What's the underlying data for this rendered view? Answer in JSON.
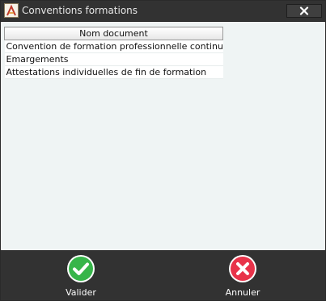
{
  "window": {
    "title": "Conventions formations",
    "icon": "app-logo-icon",
    "close_icon": "close-icon"
  },
  "table": {
    "column_header": "Nom document",
    "rows": [
      "Convention de formation professionnelle continue",
      "Emargements",
      "Attestations individuelles de fin de formation"
    ]
  },
  "footer": {
    "validate_label": "Valider",
    "cancel_label": "Annuler",
    "validate_icon": "check-icon",
    "cancel_icon": "cross-icon"
  },
  "colors": {
    "titlebar": "#323232",
    "content_bg": "#eff4f4",
    "validate": "#37b54a",
    "cancel": "#e8334a"
  }
}
